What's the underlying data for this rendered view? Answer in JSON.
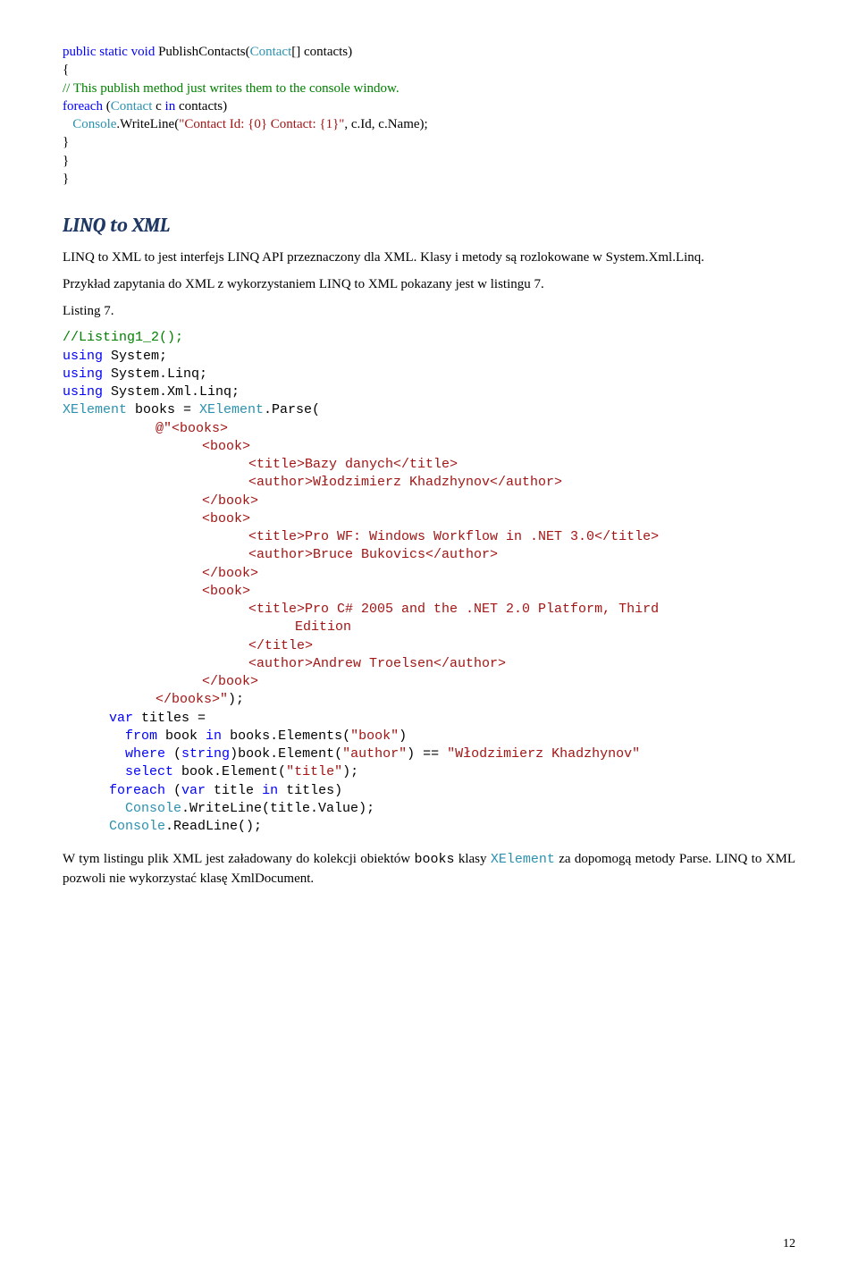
{
  "code_top": {
    "line1": {
      "pre": "public static void ",
      "method": "PublishContacts(",
      "type": "Contact",
      "after": "[] contacts)"
    },
    "line2": "{",
    "line3_comment": "// This publish method just writes them to the console window.",
    "line4": {
      "pre": "foreach ",
      "paren": "(",
      "type": "Contact",
      "after": " c ",
      "kw": "in ",
      "var": "contacts)"
    },
    "line5": {
      "cls": "Console",
      "after": ".WriteLine(",
      "str": "\"Contact Id: {0} Contact: {1}\"",
      "tail": ", c.Id, c.Name);"
    },
    "line6": "}",
    "line7": "}",
    "line8": "}"
  },
  "heading": "LINQ to XML",
  "para1": "LINQ to XML to jest interfejs LINQ API przeznaczony dla XML. Klasy i metody są rozlokowane w System.Xml.Linq.",
  "para2": "Przykład zapytania do XML  z wykorzystaniem LINQ to XML pokazany jest w listingu 7.",
  "listing_label": "Listing 7.",
  "code_main": {
    "comment": "//Listing1_2();",
    "using1": {
      "kw": "using",
      "ns": " System;"
    },
    "using2": {
      "kw": "using",
      "ns": " System.Linq;"
    },
    "using3": {
      "kw": "using",
      "ns": " System.Xml.Linq;"
    },
    "xdecl": {
      "type": "XElement",
      "var": " books = ",
      "type2": "XElement",
      "after": ".Parse("
    },
    "xml": {
      "open_books": "@\"<books>",
      "open_book1": "<book>",
      "title1": "<title>Bazy danych</title>",
      "author1": "<author>Włodzimierz Khadzhynov</author>",
      "close_book1": "</book>",
      "open_book2": "<book>",
      "title2": "<title>Pro WF: Windows Workflow in .NET 3.0</title>",
      "author2": "<author>Bruce Bukovics</author>",
      "close_book2": "</book>",
      "open_book3": "<book>",
      "title3_a": "<title>Pro C# 2005 and the .NET 2.0 Platform, Third ",
      "title3_b": "Edition",
      "title3_close": "</title>",
      "author3": "<author>Andrew Troelsen</author>",
      "close_book3": "</book>",
      "close_books": "</books>\"",
      "end_paren": ");"
    },
    "query": {
      "var_kw": "var",
      "var_rest": " titles =",
      "from_kw": "from",
      "from_rest": " book ",
      "in_kw": "in",
      "in_rest": " books.Elements(",
      "in_str": "\"book\"",
      "in_tail": ")",
      "where_kw": "where",
      "where_rest": " (",
      "where_cast": "string",
      "where_after": ")book.Element(",
      "where_str1": "\"author\"",
      "where_mid": ") == ",
      "where_str2": "\"Włodzimierz Khadzhynov\"",
      "select_kw": "select",
      "select_rest": " book.Element(",
      "select_str": "\"title\"",
      "select_tail": ");"
    },
    "foreach": {
      "kw": "foreach",
      "paren": " (",
      "var_kw": "var",
      "rest": " title ",
      "in_kw": "in",
      "tail": " titles)"
    },
    "writeline": {
      "cls": "Console",
      "rest": ".WriteLine(title.Value);"
    },
    "readline": {
      "cls": "Console",
      "rest": ".ReadLine();"
    }
  },
  "para3_a": "W tym listingu plik XML jest załadowany do kolekcji obiektów ",
  "para3_b": "books",
  "para3_c": " klasy ",
  "para3_d": "XElement",
  "para3_e": " za dopomogą metody Parse.  LINQ to XML pozwoli nie wykorzystać klasę XmlDocument.",
  "page_number": "12"
}
